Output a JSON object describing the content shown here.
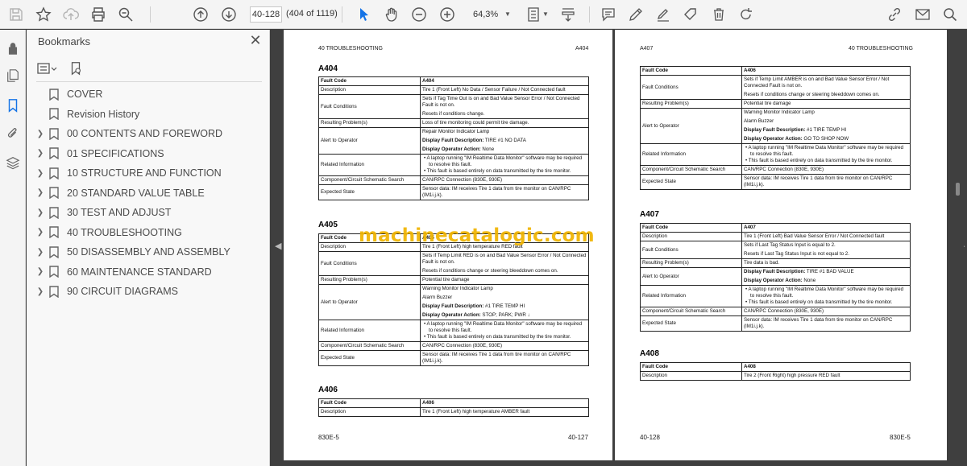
{
  "toolbar": {
    "page_field": "40-128",
    "page_count": "(404 of 1119)",
    "zoom": "64,3%"
  },
  "icons": [
    "save-icon",
    "star-icon",
    "cloud-upload-icon",
    "print-icon",
    "zoom-search-icon",
    "prev-page-icon",
    "next-page-icon",
    "select-cursor-icon",
    "hand-icon",
    "zoom-out-icon",
    "zoom-in-icon",
    "page-fit-icon",
    "scroll-mode-icon",
    "comment-icon",
    "pen-icon",
    "sign-icon",
    "stamp-icon",
    "delete-icon",
    "redo-icon",
    "link-icon",
    "email-icon",
    "search-icon"
  ],
  "bookmarks": {
    "title": "Bookmarks",
    "items": [
      {
        "label": "COVER",
        "expandable": false
      },
      {
        "label": "Revision History",
        "expandable": false
      },
      {
        "label": "00 CONTENTS AND FOREWORD",
        "expandable": true
      },
      {
        "label": "01 SPECIFICATIONS",
        "expandable": true
      },
      {
        "label": "10 STRUCTURE AND FUNCTION",
        "expandable": true
      },
      {
        "label": "20 STANDARD VALUE TABLE",
        "expandable": true
      },
      {
        "label": "30 TEST AND ADJUST",
        "expandable": true
      },
      {
        "label": "40 TROUBLESHOOTING",
        "expandable": true
      },
      {
        "label": "50 DISASSEMBLY AND ASSEMBLY",
        "expandable": true
      },
      {
        "label": "60 MAINTENANCE STANDARD",
        "expandable": true
      },
      {
        "label": "90 CIRCUIT DIAGRAMS",
        "expandable": true
      }
    ]
  },
  "watermark": "machinecatalogic.com",
  "left_page": {
    "header_left": "40 TROUBLESHOOTING",
    "header_right": "A404",
    "footer_left": "830E-5",
    "footer_right": "40-127",
    "a404": {
      "title": "A404",
      "fault_code_label": "Fault Code",
      "fault_code": "A404",
      "description_label": "Description",
      "description": "Tire 1 (Front Left) No Data / Sensor Failure / Not Connected fault",
      "conditions_label": "Fault Conditions",
      "conditions_1": "Sets if Tag Time Out is on and Bad Value Sensor Error / Not Connected Fault is not on.",
      "conditions_2": "Resets if conditions change.",
      "problem_label": "Resulting Problem(s)",
      "problem": "Loss of tire monitoring could permit tire damage.",
      "alert_label": "Alert to Operator",
      "alert_1": "Repair Monitor Indicator Lamp",
      "alert_2_label": "Display Fault Description:",
      "alert_2": " TIRE #1 NO DATA",
      "alert_3_label": "Display Operator Action:",
      "alert_3": " None",
      "related_label": "Related Information",
      "related_1": "A laptop running \"IM Realtime Data Monitor\" software may be required to resolve this fault.",
      "related_2": "This fault is based entirely on data transmitted by the tire monitor.",
      "schematic_label": "Component/Circuit Schematic Search",
      "schematic": "CAN/RPC Connection (830E, 930E)",
      "expected_label": "Expected State",
      "expected": "Sensor data: IM receives Tire 1 data from tire monitor on CAN/RPC (IM1i.j.k)."
    },
    "a405": {
      "title": "A405",
      "fault_code_label": "Fault Code",
      "fault_code": "A405",
      "description_label": "Description",
      "description": "Tire 1 (Front Left) high temperature RED fault",
      "conditions_label": "Fault Conditions",
      "conditions_1": "Sets if Temp Limit RED is on and Bad Value Sensor Error / Not Connected Fault is not on.",
      "conditions_2": "Resets if conditions change or steering bleeddown comes on.",
      "problem_label": "Resulting Problem(s)",
      "problem": "Potential tire damage",
      "alert_label": "Alert to Operator",
      "alert_1": "Warning Monitor Indicator Lamp",
      "alert_1b": "Alarm Buzzer",
      "alert_2_label": "Display Fault Description:",
      "alert_2": " #1 TIRE TEMP HI",
      "alert_3_label": "Display Operator Action:",
      "alert_3": " STOP; PARK; PWR ↓",
      "related_label": "Related Information",
      "related_1": "A laptop running \"IM Realtime Data Monitor\" software may be required to resolve this fault.",
      "related_2": "This fault is based entirely on data transmitted by the tire monitor.",
      "schematic_label": "Component/Circuit Schematic Search",
      "schematic": "CAN/RPC Connection (830E, 930E)",
      "expected_label": "Expected State",
      "expected": "Sensor data: IM receives Tire 1 data from tire monitor on CAN/RPC (IM1i.j.k)."
    },
    "a406": {
      "title": "A406",
      "fault_code_label": "Fault Code",
      "fault_code": "A406",
      "description_label": "Description",
      "description": "Tire 1 (Front Left) high temperature AMBER fault"
    }
  },
  "right_page": {
    "header_left": "A407",
    "header_right": "40 TROUBLESHOOTING",
    "footer_left": "40-128",
    "footer_right": "830E-5",
    "a406": {
      "fault_code_label": "Fault Code",
      "fault_code": "A406",
      "conditions_label": "Fault Conditions",
      "conditions_1": "Sets if Temp Limit AMBER is on and Bad Value Sensor Error / Not Connected Fault is not on.",
      "conditions_2": "Resets if conditions change or steering bleeddown comes on.",
      "problem_label": "Resulting Problem(s)",
      "problem": "Potential tire damage",
      "alert_label": "Alert to Operator",
      "alert_1": "Warning Monitor Indicator Lamp",
      "alert_1b": "Alarm Buzzer",
      "alert_2_label": "Display Fault Description:",
      "alert_2": " #1 TIRE TEMP HI",
      "alert_3_label": "Display Operator Action:",
      "alert_3": " GO TO SHOP NOW",
      "related_label": "Related Information",
      "related_1": "A laptop running \"IM Realtime Data Monitor\" software may be required to resolve this fault.",
      "related_2": "This fault is based entirely on data transmitted by the tire monitor.",
      "schematic_label": "Component/Circuit Schematic Search",
      "schematic": "CAN/RPC Connection (830E, 930E)",
      "expected_label": "Expected State",
      "expected": "Sensor data: IM receives Tire 1 data from tire monitor on CAN/RPC (IM1i.j.k)."
    },
    "a407": {
      "title": "A407",
      "fault_code_label": "Fault Code",
      "fault_code": "A407",
      "description_label": "Description",
      "description": "Tire 1 (Front Left) Bad Value Sensor Error / Not Connected fault",
      "conditions_label": "Fault Conditions",
      "conditions_1": "Sets if Last Tag Status Input is equal to 2.",
      "conditions_2": "Resets if Last Tag Status Input is not equal to 2.",
      "problem_label": "Resulting Problem(s)",
      "problem": "Tire data is bad.",
      "alert_label": "Alert to Operator",
      "alert_2_label": "Display Fault Description:",
      "alert_2": " TIRE #1 BAD VALUE",
      "alert_3_label": "Display Operator Action:",
      "alert_3": " None",
      "related_label": "Related Information",
      "related_1": "A laptop running \"IM Realtime Data Monitor\" software may be required to resolve this fault.",
      "related_2": "This fault is based entirely on data transmitted by the tire monitor.",
      "schematic_label": "Component/Circuit Schematic Search",
      "schematic": "CAN/RPC Connection (830E, 930E)",
      "expected_label": "Expected State",
      "expected": "Sensor data: IM receives Tire 1 data from tire monitor on CAN/RPC (IM1i.j.k)."
    },
    "a408": {
      "title": "A408",
      "fault_code_label": "Fault Code",
      "fault_code": "A408",
      "description_label": "Description",
      "description": "Tire 2 (Front Right) high pressure RED fault"
    }
  }
}
